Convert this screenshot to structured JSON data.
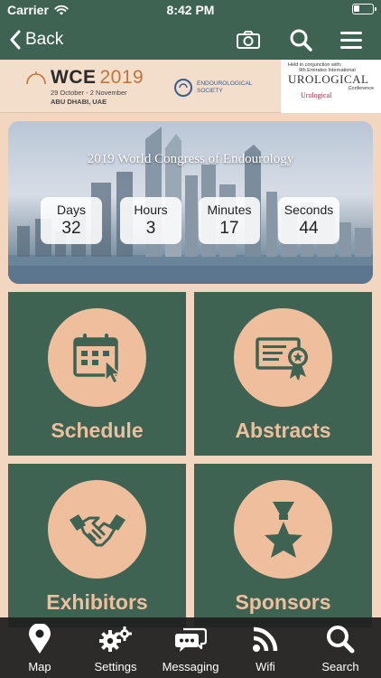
{
  "status_bar": {
    "carrier": "Carrier",
    "time": "8:42 PM"
  },
  "nav": {
    "back_label": "Back",
    "icons": [
      "camera-icon",
      "search-icon",
      "menu-icon"
    ]
  },
  "banner": {
    "logo_word": "WCE",
    "logo_year": "2019",
    "dates": "29 October - 2 November",
    "location": "ABU DHABI, UAE",
    "society_line1": "ENDOUROLOGICAL",
    "society_line2": "SOCIETY",
    "held_text": "Held in conjunction with:",
    "uro_small": "9th Emirates International",
    "uro_word": "UROLOGICAL",
    "uro_conf": "Conference",
    "uro_society": "Urological"
  },
  "hero": {
    "title": "2019 World Congress of Endourology",
    "countdown": [
      {
        "label": "Days",
        "value": "32"
      },
      {
        "label": "Hours",
        "value": "3"
      },
      {
        "label": "Minutes",
        "value": "17"
      },
      {
        "label": "Seconds",
        "value": "44"
      }
    ]
  },
  "tiles": [
    {
      "label": "Schedule",
      "icon": "calendar-icon"
    },
    {
      "label": "Abstracts",
      "icon": "certificate-icon"
    },
    {
      "label": "Exhibitors",
      "icon": "handshake-icon"
    },
    {
      "label": "Sponsors",
      "icon": "award-star-icon"
    }
  ],
  "tab_bar": [
    {
      "label": "Map",
      "icon": "map-pin-icon"
    },
    {
      "label": "Settings",
      "icon": "gears-icon"
    },
    {
      "label": "Messaging",
      "icon": "chat-icon"
    },
    {
      "label": "Wifi",
      "icon": "wifi-icon"
    },
    {
      "label": "Search",
      "icon": "search-icon"
    }
  ],
  "colors": {
    "primary_green": "#3f6352",
    "accent_peach": "#efbf9d",
    "background": "#f2d6c0",
    "tab_bar": "#202020"
  }
}
